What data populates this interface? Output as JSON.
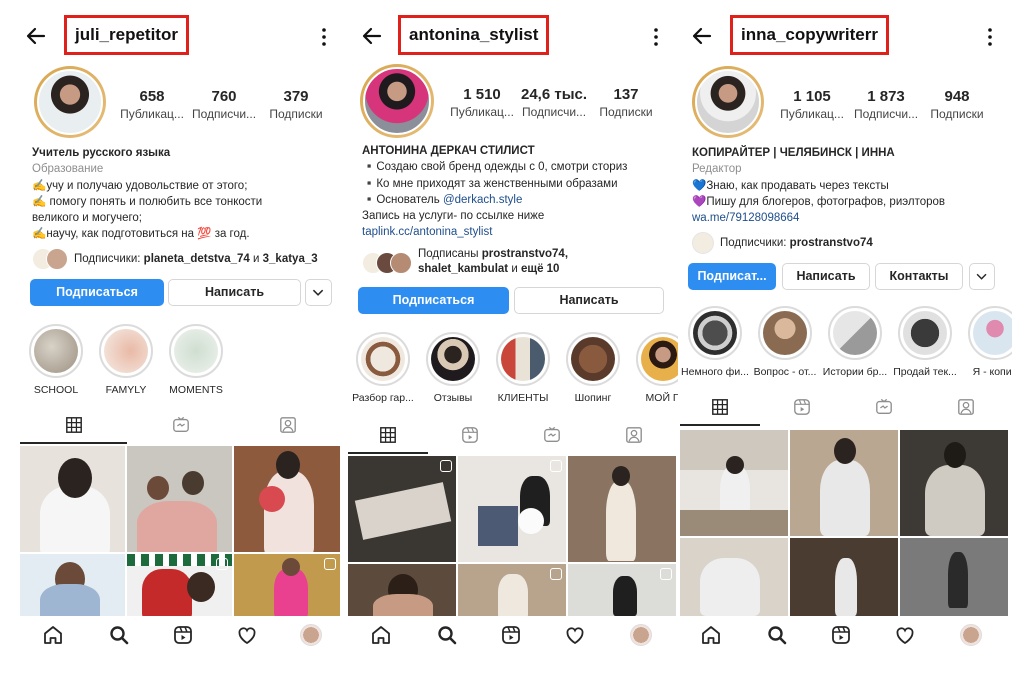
{
  "profiles": [
    {
      "username": "juli_repetitor",
      "stats": [
        {
          "value": "658",
          "label": "Публикац..."
        },
        {
          "value": "760",
          "label": "Подписчи..."
        },
        {
          "value": "379",
          "label": "Подписки"
        }
      ],
      "bio": {
        "name": "Учитель русского языка",
        "category": "Образование",
        "lines": [
          "✍️учу и получаю удовольствие от этого;",
          "✍️ помогу понять и полюбить все тонкости",
          "великого и могучего;",
          "✍️научу, как подготовиться на 💯 за год."
        ]
      },
      "followed_by": {
        "prefix": "Подписчики:",
        "names": "planeta_detstva_74",
        "joiner": "и",
        "rest": "3_katya_3"
      },
      "buttons": {
        "primary": "Подписаться",
        "message": "Написать"
      },
      "highlights": [
        "SCHOOL",
        "FAMYLY",
        "MOMENTS"
      ]
    },
    {
      "username": "antonina_stylist",
      "stats": [
        {
          "value": "1 510",
          "label": "Публикац..."
        },
        {
          "value": "24,6 тыс.",
          "label": "Подписчи..."
        },
        {
          "value": "137",
          "label": "Подписки"
        }
      ],
      "bio": {
        "name": "АНТОНИНА ДЕРКАЧ СТИЛИСТ",
        "lines": [
          "▪️Создаю свой бренд одежды с 0, смотри сториз",
          "▪️Ко мне приходят за женственными образами",
          "▪️Основатель",
          "Запись на услуги- по ссылке ниже"
        ],
        "mention": "@derkach.style",
        "link": "taplink.cc/antonina_stylist"
      },
      "followed_by": {
        "prefix": "Подписаны",
        "names": "prostranstvo74,",
        "names2": "shalet_kambulat",
        "joiner": "и",
        "rest": "ещё 10"
      },
      "buttons": {
        "primary": "Подписаться",
        "message": "Написать"
      },
      "highlights": [
        "Разбор гар...",
        "Отзывы",
        "КЛИЕНТЫ",
        "Шопинг",
        "МОЙ П"
      ]
    },
    {
      "username": "inna_copywriterr",
      "stats": [
        {
          "value": "1 105",
          "label": "Публикац..."
        },
        {
          "value": "1 873",
          "label": "Подписчи..."
        },
        {
          "value": "948",
          "label": "Подписки"
        }
      ],
      "bio": {
        "name": "КОПИРАЙТЕР | ЧЕЛЯБИНСК | ИННА",
        "category": "Редактор",
        "lines": [
          "💙Знаю, как продавать через тексты",
          "💜Пишу для блогеров, фотографов, риэлторов"
        ],
        "link": "wa.me/79128098664"
      },
      "followed_by": {
        "prefix": "Подписчики:",
        "names": "prostranstvo74"
      },
      "buttons": {
        "primary": "Подписат...",
        "message": "Написать",
        "contacts": "Контакты"
      },
      "highlights": [
        "Немного фи...",
        "Вопрос - от...",
        "Истории бр...",
        "Продай тек...",
        "Я - копир"
      ]
    }
  ],
  "colors": {
    "accent": "#2d8df0",
    "highlight_box": "#e0201b",
    "avatar_ring": "#d8a74f",
    "link": "#1e4e8c"
  },
  "icons": [
    "back-arrow-icon",
    "more-vertical-icon",
    "grid-icon",
    "reels-icon",
    "igtv-icon",
    "tagged-icon",
    "home-icon",
    "search-icon",
    "reels-nav-icon",
    "heart-icon",
    "profile-avatar-icon"
  ]
}
